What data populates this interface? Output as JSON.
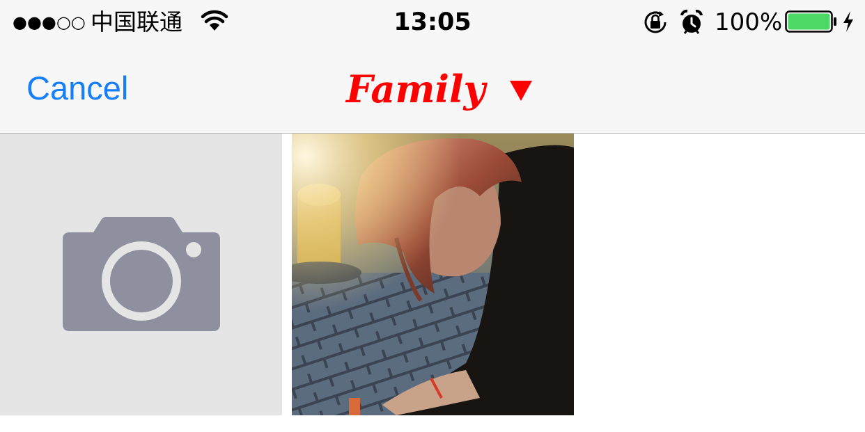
{
  "status_bar": {
    "signal": "●●●○○",
    "carrier": "中国联通",
    "time": "13:05",
    "battery_percent": "100%",
    "battery_level": 1.0,
    "icons": [
      "wifi-icon",
      "rotation-lock-icon",
      "alarm-icon",
      "battery-icon",
      "charging-bolt-icon"
    ]
  },
  "nav_bar": {
    "cancel_label": "Cancel",
    "title": "Family",
    "dropdown_icon": "triangle-down-icon"
  },
  "colors": {
    "accent": "#147efb",
    "title": "#ff0000",
    "battery_fill": "#4cd964",
    "camera_cell_bg": "#e5e5e5",
    "camera_icon": "#8e90a0"
  },
  "grid": {
    "items": [
      {
        "kind": "camera",
        "icon": "camera-icon"
      },
      {
        "kind": "photo"
      }
    ]
  }
}
